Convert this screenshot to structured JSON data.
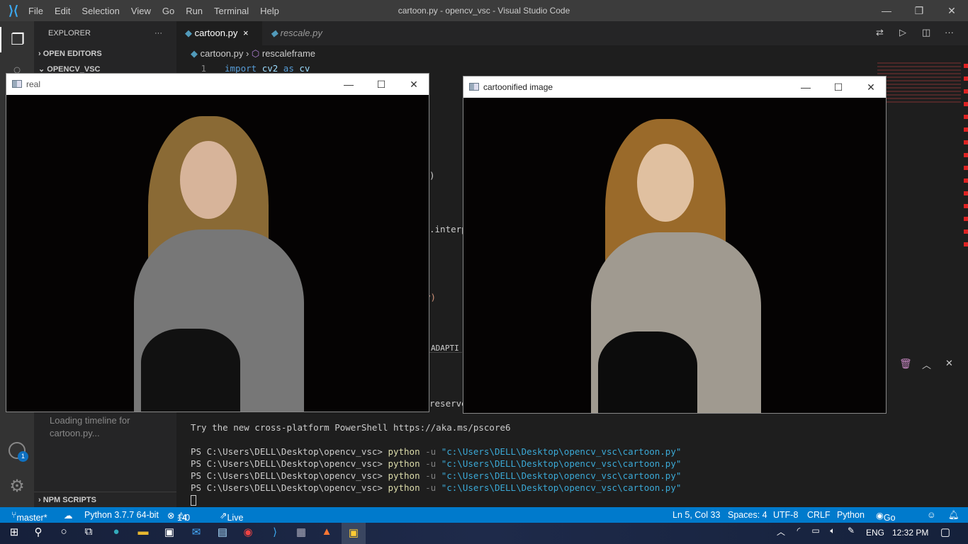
{
  "window_title": "cartoon.py - opencv_vsc - Visual Studio Code",
  "menu": [
    "File",
    "Edit",
    "Selection",
    "View",
    "Go",
    "Run",
    "Terminal",
    "Help"
  ],
  "sidebar": {
    "title": "EXPLORER",
    "more": "···",
    "open_editors": "OPEN EDITORS",
    "folder": "OPENCV_VSC",
    "timeline_msg": "Loading timeline for cartoon.py...",
    "npm": "NPM SCRIPTS"
  },
  "accounts_badge": "1",
  "tabs": [
    {
      "label": "cartoon.py",
      "active": true,
      "close": "×"
    },
    {
      "label": "rescale.py",
      "active": false
    }
  ],
  "breadcrumb": {
    "file": "cartoon.py",
    "symbol": "rescaleframe"
  },
  "code": {
    "line_no": "1",
    "kw1": "import",
    "mod": "cv2",
    "kw2": "as",
    "alias": "cv",
    "frag1": ")",
    "frag2": ".interp",
    "frag3": "y)",
    "frag4": "ADAPTI",
    "frag5": "reserve"
  },
  "terminal": {
    "intro": "Try the new cross-platform PowerShell https://aka.ms/pscore6",
    "prompt": "PS C:\\Users\\DELL\\Desktop\\opencv_vsc> ",
    "cmd": "python",
    "flag": " -u ",
    "arg": "\"c:\\Users\\DELL\\Desktop\\opencv_vsc\\cartoon.py\"",
    "count": 4
  },
  "windows": [
    {
      "title": "real"
    },
    {
      "title": "cartoonified image"
    }
  ],
  "status": {
    "branch": "master*",
    "python": "Python 3.7.7 64-bit",
    "errors": "14",
    "warnings": "0",
    "liveshare": "Live Share",
    "position": "Ln 5, Col 33",
    "spaces": "Spaces: 4",
    "encoding": "UTF-8",
    "eol": "CRLF",
    "language": "Python",
    "golive": "Go Live"
  },
  "tray": {
    "lang": "ENG",
    "time": "12:32 PM"
  },
  "colors": {
    "accent": "#007acc",
    "keyword": "#569cd6",
    "python_cmd": "#dcdcaa",
    "string": "#3ba9d6"
  }
}
